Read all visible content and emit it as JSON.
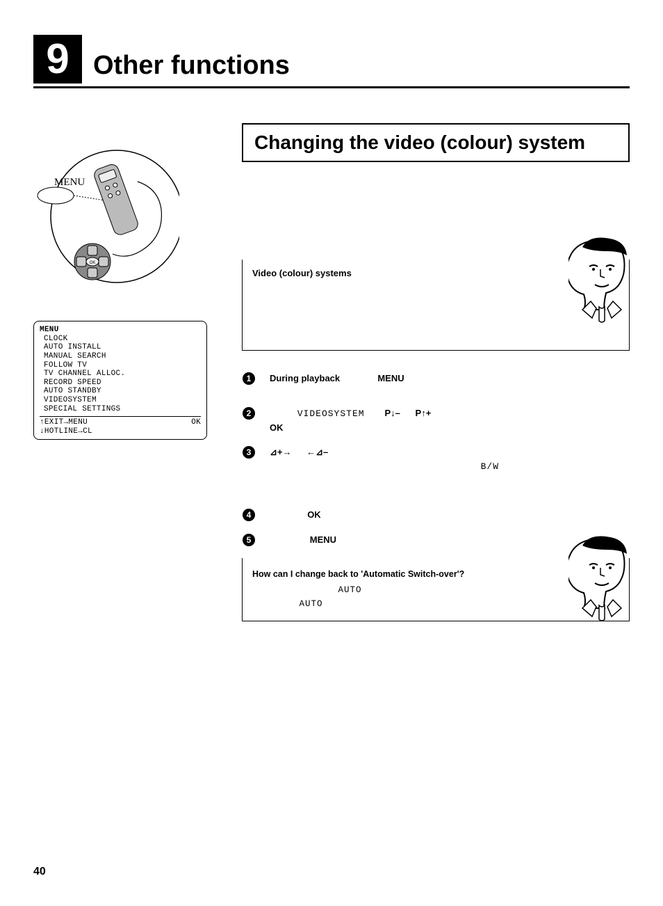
{
  "chapter": {
    "number": "9",
    "title": "Other functions"
  },
  "section_title": "Changing the video (colour) system",
  "left": {
    "callout_label": "MENU",
    "osd": {
      "title": "MENU",
      "items": [
        "CLOCK",
        "AUTO INSTALL",
        "MANUAL SEARCH",
        "FOLLOW TV",
        "TV CHANNEL ALLOC.",
        "RECORD SPEED",
        "AUTO STANDBY",
        "VIDEOSYSTEM",
        "SPECIAL SETTINGS"
      ],
      "foot_left_1": "↑EXIT→MENU",
      "foot_right_1": "OK",
      "foot_left_2": "↓HOTLINE→CL"
    }
  },
  "info_box": {
    "label": "Video (colour) systems"
  },
  "steps": {
    "s1": {
      "a": "During playback",
      "menu": "MENU"
    },
    "s2": {
      "videosystem": "VIDEOSYSTEM",
      "pdown": "P↓–",
      "pup": "P↑+",
      "ok": "OK"
    },
    "s3": {
      "right": "⊿+→",
      "left": "←⊿–",
      "bw": "B/W"
    },
    "s4": {
      "ok": "OK"
    },
    "s5": {
      "menu": "MENU"
    }
  },
  "faq": {
    "question": "How can I change back to 'Automatic Switch-over'?",
    "auto1": "AUTO",
    "auto2": "AUTO"
  },
  "page_number": "40"
}
